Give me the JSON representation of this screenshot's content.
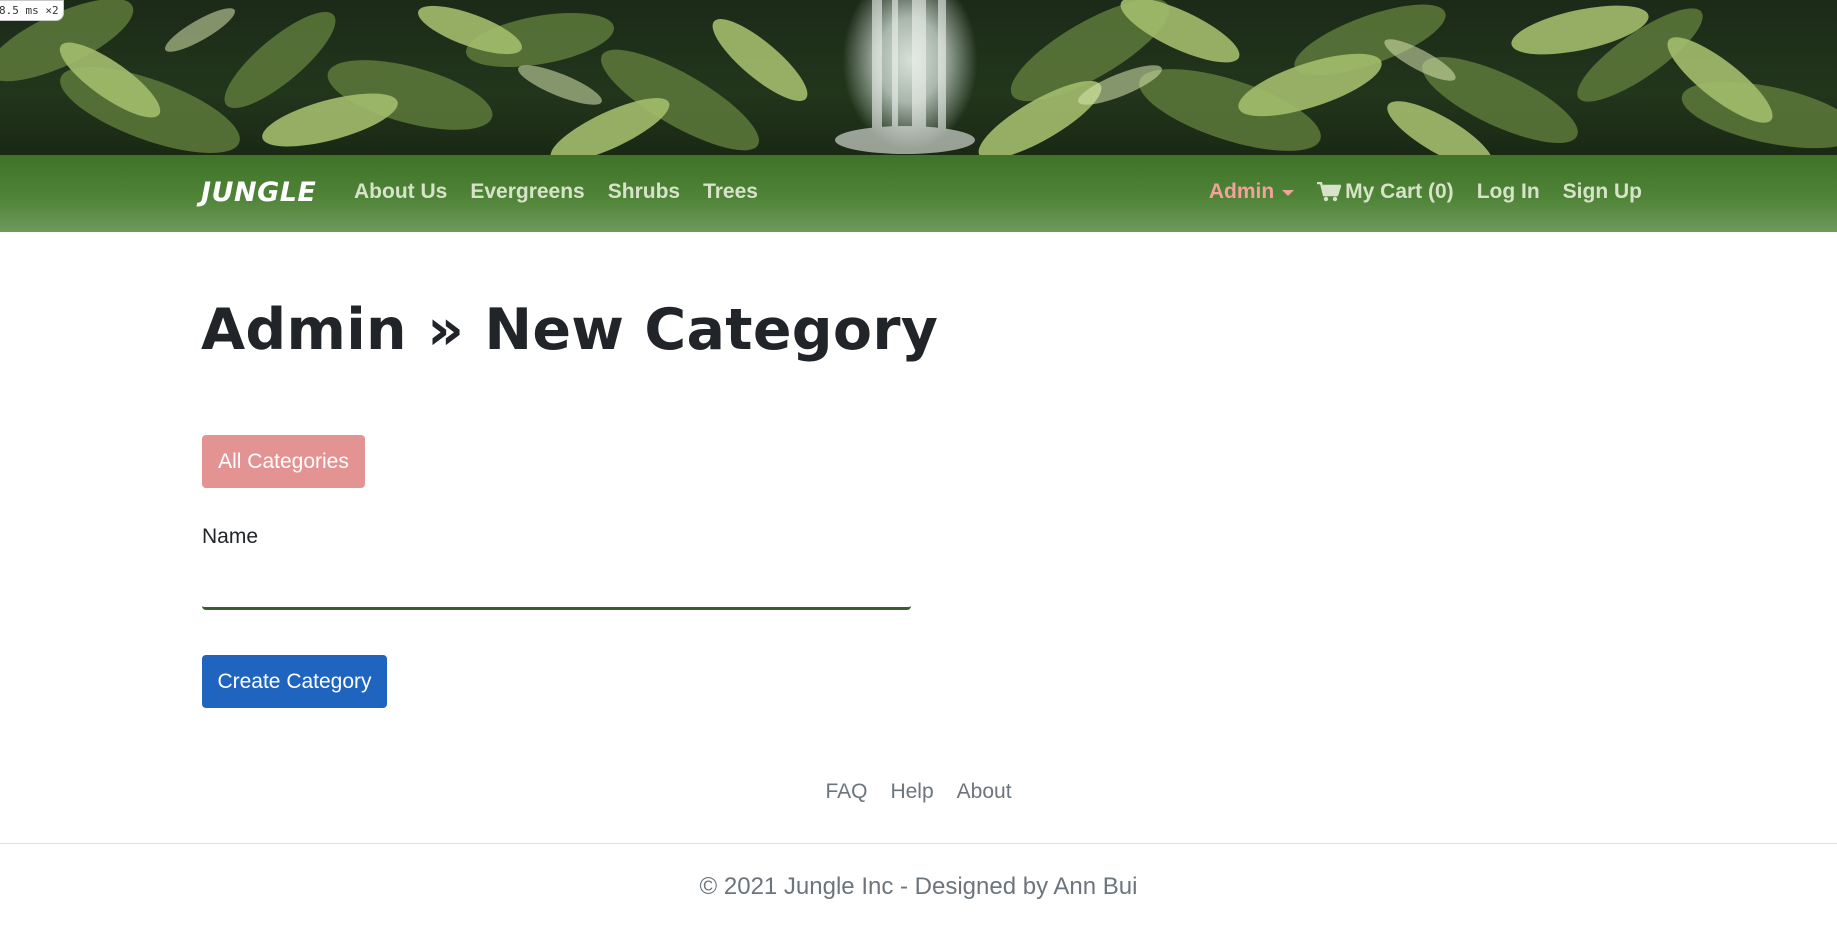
{
  "perf_badge": "8.5 ms ×2",
  "nav": {
    "brand": "JUNGLE",
    "left_links": [
      "About Us",
      "Evergreens",
      "Shrubs",
      "Trees"
    ],
    "admin_label": "Admin",
    "cart_label": "My Cart (0)",
    "login_label": "Log In",
    "signup_label": "Sign Up"
  },
  "main": {
    "title": "Admin » New Category",
    "all_categories_button": "All Categories",
    "name_label": "Name",
    "name_value": "",
    "create_button": "Create Category"
  },
  "footer": {
    "links": [
      "FAQ",
      "Help",
      "About"
    ],
    "copyright": "© 2021 Jungle Inc - Designed by Ann Bui"
  },
  "colors": {
    "navbar": "#4f8438",
    "nav_link": "#d6e3c8",
    "admin_accent": "#f0a29b",
    "categories_button": "#e49393",
    "create_button": "#1f64bf",
    "input_underline": "#3d5b32"
  },
  "icons": {
    "cart": "shopping-cart-icon",
    "admin_caret": "caret-down-icon"
  }
}
